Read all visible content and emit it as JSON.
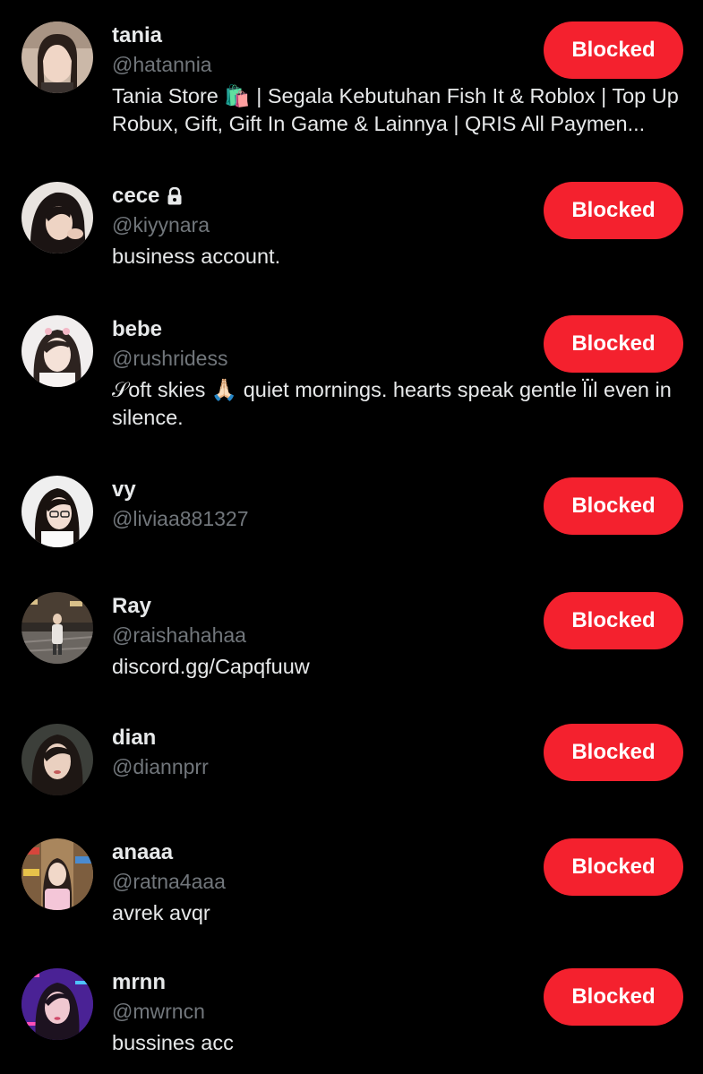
{
  "colors": {
    "background": "#000000",
    "primary_text": "#e7e9ea",
    "secondary_text": "#71767b",
    "blocked_button": "#f4212e"
  },
  "accounts": [
    {
      "name": "tania",
      "handle": "@hatannia",
      "bio": "Tania Store 🛍️ | Segala Kebutuhan Fish It & Roblox | Top Up Robux, Gift, Gift In Game & Lainnya | QRIS All Paymen...",
      "button_label": "Blocked",
      "protected": false,
      "avatar_icon": "avatar-photo"
    },
    {
      "name": "cece",
      "handle": "@kiyynara",
      "bio": "business account.",
      "button_label": "Blocked",
      "protected": true,
      "avatar_icon": "avatar-photo"
    },
    {
      "name": "bebe",
      "handle": "@rushridess",
      "bio": "𝒮oft skies 🙏🏻 quiet mornings. hearts speak gentle l̈ı̈l even in silence.",
      "button_label": "Blocked",
      "protected": false,
      "avatar_icon": "avatar-photo"
    },
    {
      "name": "vy",
      "handle": "@liviaa881327",
      "bio": "",
      "button_label": "Blocked",
      "protected": false,
      "avatar_icon": "avatar-photo"
    },
    {
      "name": "Ray",
      "handle": "@raishahahaa",
      "bio": "discord.gg/Capqfuuw",
      "button_label": "Blocked",
      "protected": false,
      "avatar_icon": "avatar-photo"
    },
    {
      "name": "dian",
      "handle": "@diannprr",
      "bio": "",
      "button_label": "Blocked",
      "protected": false,
      "avatar_icon": "avatar-photo"
    },
    {
      "name": "anaaa",
      "handle": "@ratna4aaa",
      "bio": "avrek avqr",
      "button_label": "Blocked",
      "protected": false,
      "avatar_icon": "avatar-photo"
    },
    {
      "name": "mrnn",
      "handle": "@mwrncn",
      "bio": "bussines acc",
      "button_label": "Blocked",
      "protected": false,
      "avatar_icon": "avatar-photo"
    }
  ]
}
